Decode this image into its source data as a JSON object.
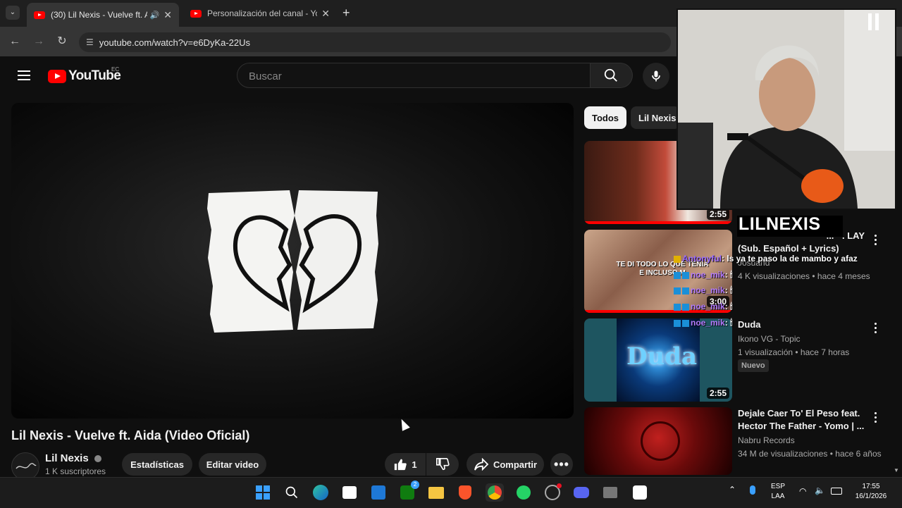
{
  "browser": {
    "tabs": [
      {
        "title": "(30) Lil Nexis - Vuelve ft. Aida",
        "active": true
      },
      {
        "title": "Personalización del canal - YouTube",
        "active": false
      }
    ],
    "url": "youtube.com/watch?v=e6DyKa-22Us"
  },
  "youtube": {
    "logo_text": "YouTube",
    "country": "EC",
    "search_placeholder": "Buscar"
  },
  "video": {
    "title": "Lil Nexis - Vuelve ft. Aida (Video Oficial)",
    "channel": "Lil Nexis",
    "subscribers": "1 K suscriptores",
    "stats_button": "Estadísticas",
    "edit_button": "Editar video",
    "likes": "1",
    "share_label": "Compartir"
  },
  "sidebar": {
    "chips": [
      "Todos",
      "Lil Nexis"
    ],
    "items": [
      {
        "title": "",
        "channel": "",
        "meta": "",
        "duration": "2:55",
        "colors": [
          "#5a2418",
          "#c8342c"
        ]
      },
      {
        "title_line1": "... · . LAY",
        "title_line2": "(Sub. Español + Lyrics)",
        "channel": "Josuand",
        "meta": "4 K visualizaciones • hace 4 meses",
        "duration": "3:00",
        "thumb_text1": "TE DI TODO LO QUE TENÍA",
        "thumb_text2": "E INCLUSO M"
      },
      {
        "title": "Duda",
        "channel": "Ikono VG - Topic",
        "meta": "1 visualización • hace 7 horas",
        "badge": "Nuevo",
        "duration": "2:55",
        "thumb_text": "Duda"
      },
      {
        "title_line1": "Dejale Caer To' El Peso feat.",
        "title_line2": "Hector The Father - Yomo | ...",
        "channel": "Nabru Records",
        "meta": "34 M de visualizaciones • hace 6 años"
      }
    ]
  },
  "overlay": {
    "streamer": "LILNEXIS",
    "chat": [
      {
        "user": "Antonyful",
        "msg": ": ls ya te paso la de mambo y afaz"
      },
      {
        "user": "noe_mik",
        "msg": ": 🕯"
      },
      {
        "user": "noe_mik",
        "msg": ": 🕯"
      },
      {
        "user": "noe_mik",
        "msg": ": 🕯"
      },
      {
        "user": "noe_mik",
        "msg": ": 🕯"
      }
    ]
  },
  "taskbar": {
    "lang_top": "ESP",
    "lang_bottom": "LAA",
    "time": "17:55",
    "date": "16/1/2026",
    "xbox_badge": "2"
  }
}
